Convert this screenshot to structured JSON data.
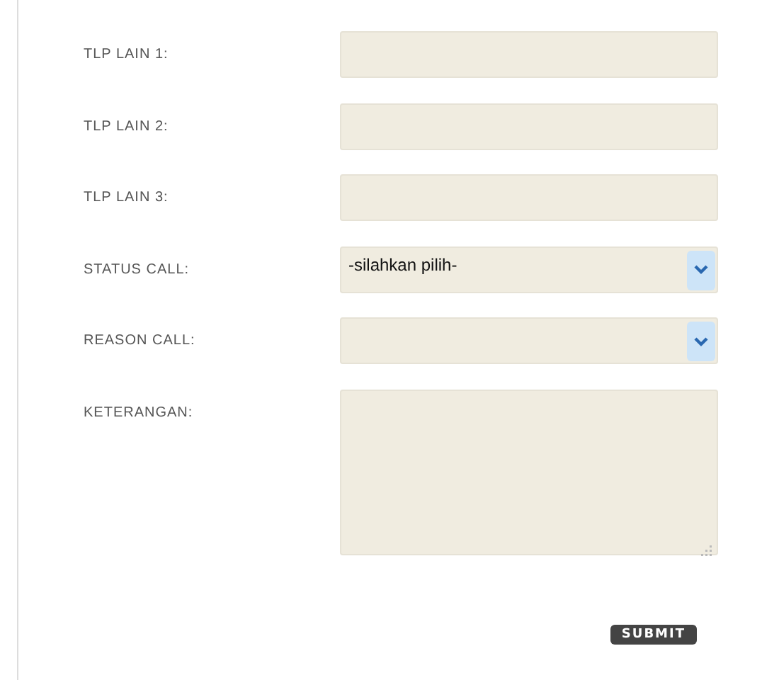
{
  "fields": [
    {
      "label": "TLP LAIN 1:",
      "kind": "text"
    },
    {
      "label": "TLP LAIN 2:",
      "kind": "text"
    },
    {
      "label": "TLP LAIN 3:",
      "kind": "text"
    },
    {
      "label": "STATUS CALL:",
      "kind": "select",
      "value": "-silahkan pilih-"
    },
    {
      "label": "REASON CALL:",
      "kind": "select"
    },
    {
      "label": "KETERANGAN:",
      "kind": "textarea"
    }
  ],
  "submit": "SUBMIT"
}
